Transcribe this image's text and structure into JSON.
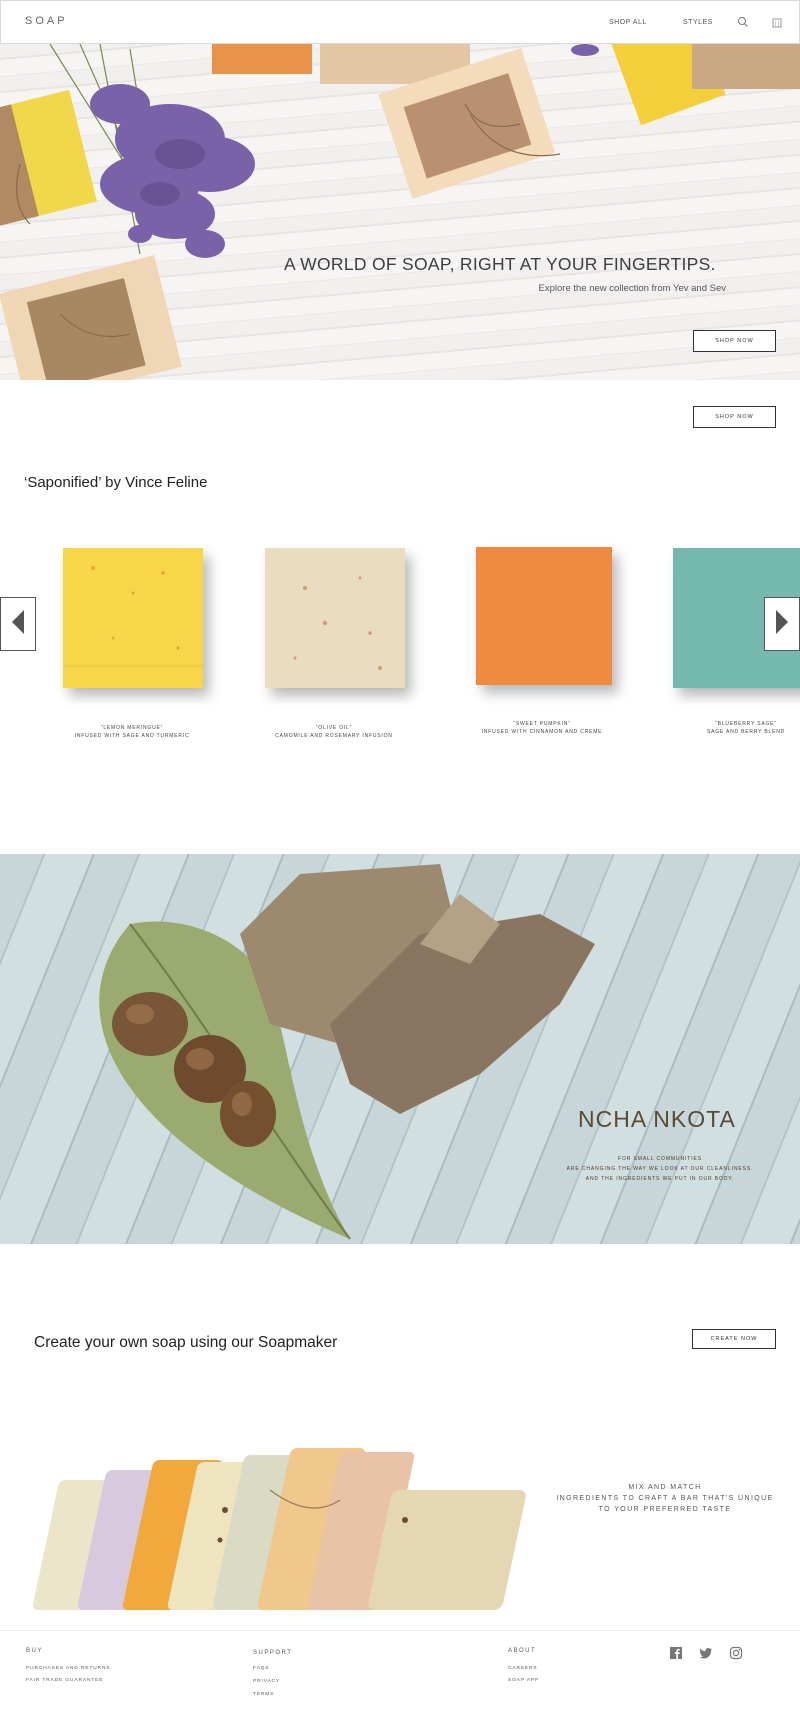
{
  "nav": {
    "logo": "SOAP",
    "shop_all": "SHOP ALL",
    "styles": "STYLES",
    "search_icon": "search-icon",
    "bag_icon": "shopping-bag-icon"
  },
  "hero": {
    "title": "A WORLD OF SOAP, RIGHT AT YOUR FINGERTIPS.",
    "subtitle": "Explore the new collection from Yev and Sev",
    "cta": "SHOP NOW"
  },
  "shop_now_secondary": "SHOP NOW",
  "collection": {
    "title": "‘Saponified’ by Vince Feline",
    "prev_icon": "chevron-left-icon",
    "next_icon": "chevron-right-icon",
    "items": [
      {
        "name": "“LEMON MERINGUE”",
        "desc": "INFUSED WITH SAGE AND TURMERIC",
        "color": "#f7d64a"
      },
      {
        "name": "“OLIVE OIL”",
        "desc": "CAMOMILE AND ROSEMARY INFUSION",
        "color": "#e9dcc0"
      },
      {
        "name": "“SWEET PUMPKIN”",
        "desc": "INFUSED WITH CINNAMON AND CREME",
        "color": "#f08a3e"
      },
      {
        "name": "“BLUEBERRY SAGE”",
        "desc": "SAGE AND BERRY BLEND",
        "color": "#74b8ae"
      }
    ]
  },
  "feature": {
    "title": "NCHA NKOTA",
    "line1": "FOR SMALL COMMUNITIES",
    "line2": "ARE CHANGING THE WAY WE LOOK AT OUR CLEANLINESS.",
    "line3": "AND THE INGREDIENTS WE PUT IN OUR BODY."
  },
  "maker": {
    "title": "Create your own soap using our Soapmaker",
    "cta": "CREATE NOW",
    "line1": "MIX AND MATCH",
    "line2": "INGREDIENTS TO CRAFT A BAR THAT'S UNIQUE",
    "line3": "TO YOUR PREFERRED TASTE"
  },
  "footer": {
    "buy": {
      "heading": "BUY",
      "links": [
        "PURCHASES AND RETURNS",
        "FAIR TRADE GUARANTEE"
      ]
    },
    "support": {
      "heading": "SUPPORT",
      "links": [
        "FAQS",
        "PRIVACY",
        "TERMS"
      ]
    },
    "about": {
      "heading": "ABOUT",
      "links": [
        "CAREERS",
        "SOAP APP"
      ]
    },
    "social": [
      "facebook-icon",
      "twitter-icon",
      "instagram-icon"
    ]
  }
}
